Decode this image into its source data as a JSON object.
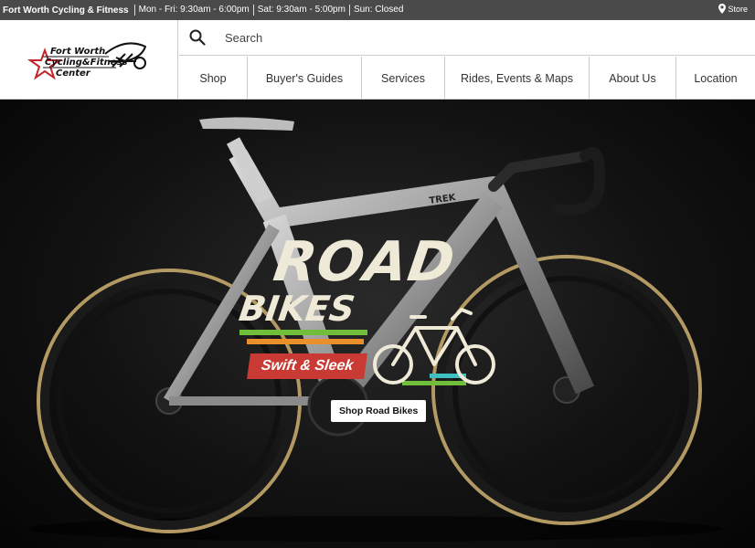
{
  "topbar": {
    "store_name": "Fort Worth Cycling & Fitness",
    "hours": [
      "Mon - Fri: 9:30am - 6:00pm",
      "Sat: 9:30am - 5:00pm",
      "Sun: Closed"
    ],
    "store_link": "Store"
  },
  "logo": {
    "line1": "Fort Worth",
    "line2": "Cycling&Fitness",
    "line3": "Center"
  },
  "search": {
    "placeholder": "Search"
  },
  "nav": {
    "items": [
      "Shop",
      "Buyer's Guides",
      "Services",
      "Rides, Events & Maps",
      "About Us",
      "Location"
    ]
  },
  "hero": {
    "headline_1": "ROAD",
    "headline_2": "BIKES",
    "tagline": "Swift & Sleek",
    "cta_label": "Shop Road Bikes",
    "frame_brand": "TREK"
  },
  "colors": {
    "topbar_bg": "#4a4a4a",
    "tagline_red": "#c93a34",
    "stripe_green": "#6fbf3a",
    "stripe_orange": "#e8902a",
    "stripe_teal": "#3fbfc4",
    "headline_cream": "#efe9d8"
  }
}
